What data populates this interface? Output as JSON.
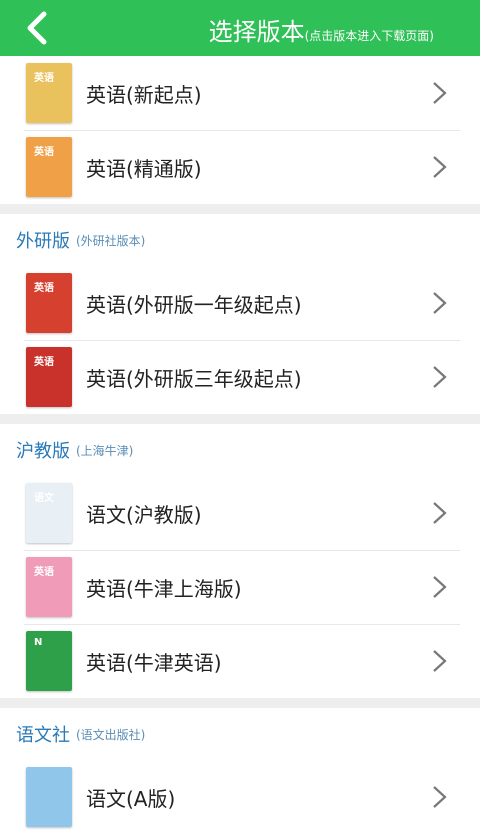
{
  "header": {
    "title": "选择版本",
    "subtitle": "(点击版本进入下载页面)"
  },
  "groups": [
    {
      "name": "",
      "sub": "",
      "items": [
        {
          "label": "英语(新起点)",
          "cover": "#e9c25e",
          "tag": "英语"
        },
        {
          "label": "英语(精通版)",
          "cover": "#f0a047",
          "tag": "英语"
        }
      ]
    },
    {
      "name": "外研版",
      "sub": "(外研社版本)",
      "items": [
        {
          "label": "英语(外研版一年级起点)",
          "cover": "#d6402e",
          "tag": "英语"
        },
        {
          "label": "英语(外研版三年级起点)",
          "cover": "#c8322b",
          "tag": "英语"
        }
      ]
    },
    {
      "name": "沪教版",
      "sub": "(上海牛津)",
      "items": [
        {
          "label": "语文(沪教版)",
          "cover": "#e8eff5",
          "tag": "语文"
        },
        {
          "label": "英语(牛津上海版)",
          "cover": "#f09bb8",
          "tag": "英语"
        },
        {
          "label": "英语(牛津英语)",
          "cover": "#2ea04a",
          "tag": "N"
        }
      ]
    },
    {
      "name": "语文社",
      "sub": "(语文出版社)",
      "items": [
        {
          "label": "语文(A版)",
          "cover": "#8fc6ea",
          "tag": ""
        }
      ]
    }
  ],
  "colors": {
    "header": "#2fc058",
    "section": "#2a7ab8"
  }
}
